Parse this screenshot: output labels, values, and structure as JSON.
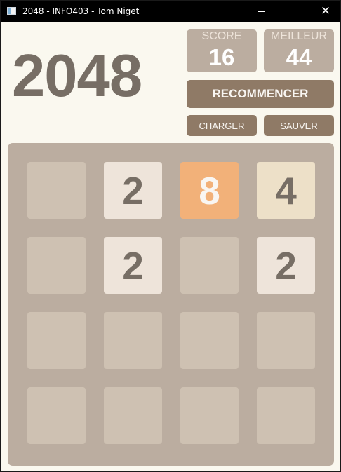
{
  "window": {
    "title": "2048 - INFO403 - Tom Niget"
  },
  "logo": "2048",
  "scores": {
    "score_label": "SCORE",
    "score_value": "16",
    "best_label": "MEILLEUR",
    "best_value": "44"
  },
  "buttons": {
    "restart": "RECOMMENCER",
    "load": "CHARGER",
    "save": "SAUVER"
  },
  "board": {
    "size": 4,
    "rows": [
      [
        "",
        "2",
        "8",
        "4"
      ],
      [
        "",
        "2",
        "",
        "2"
      ],
      [
        "",
        "",
        "",
        ""
      ],
      [
        "",
        "",
        "",
        ""
      ]
    ]
  },
  "colors": {
    "background": "#faf8ef",
    "board": "#bbada0",
    "empty_cell": "#cec1b2",
    "tile_2": "#eee4da",
    "tile_4": "#ede0c8",
    "tile_8": "#f2b179",
    "dark_text": "#776e65",
    "button": "#8f7a66"
  }
}
